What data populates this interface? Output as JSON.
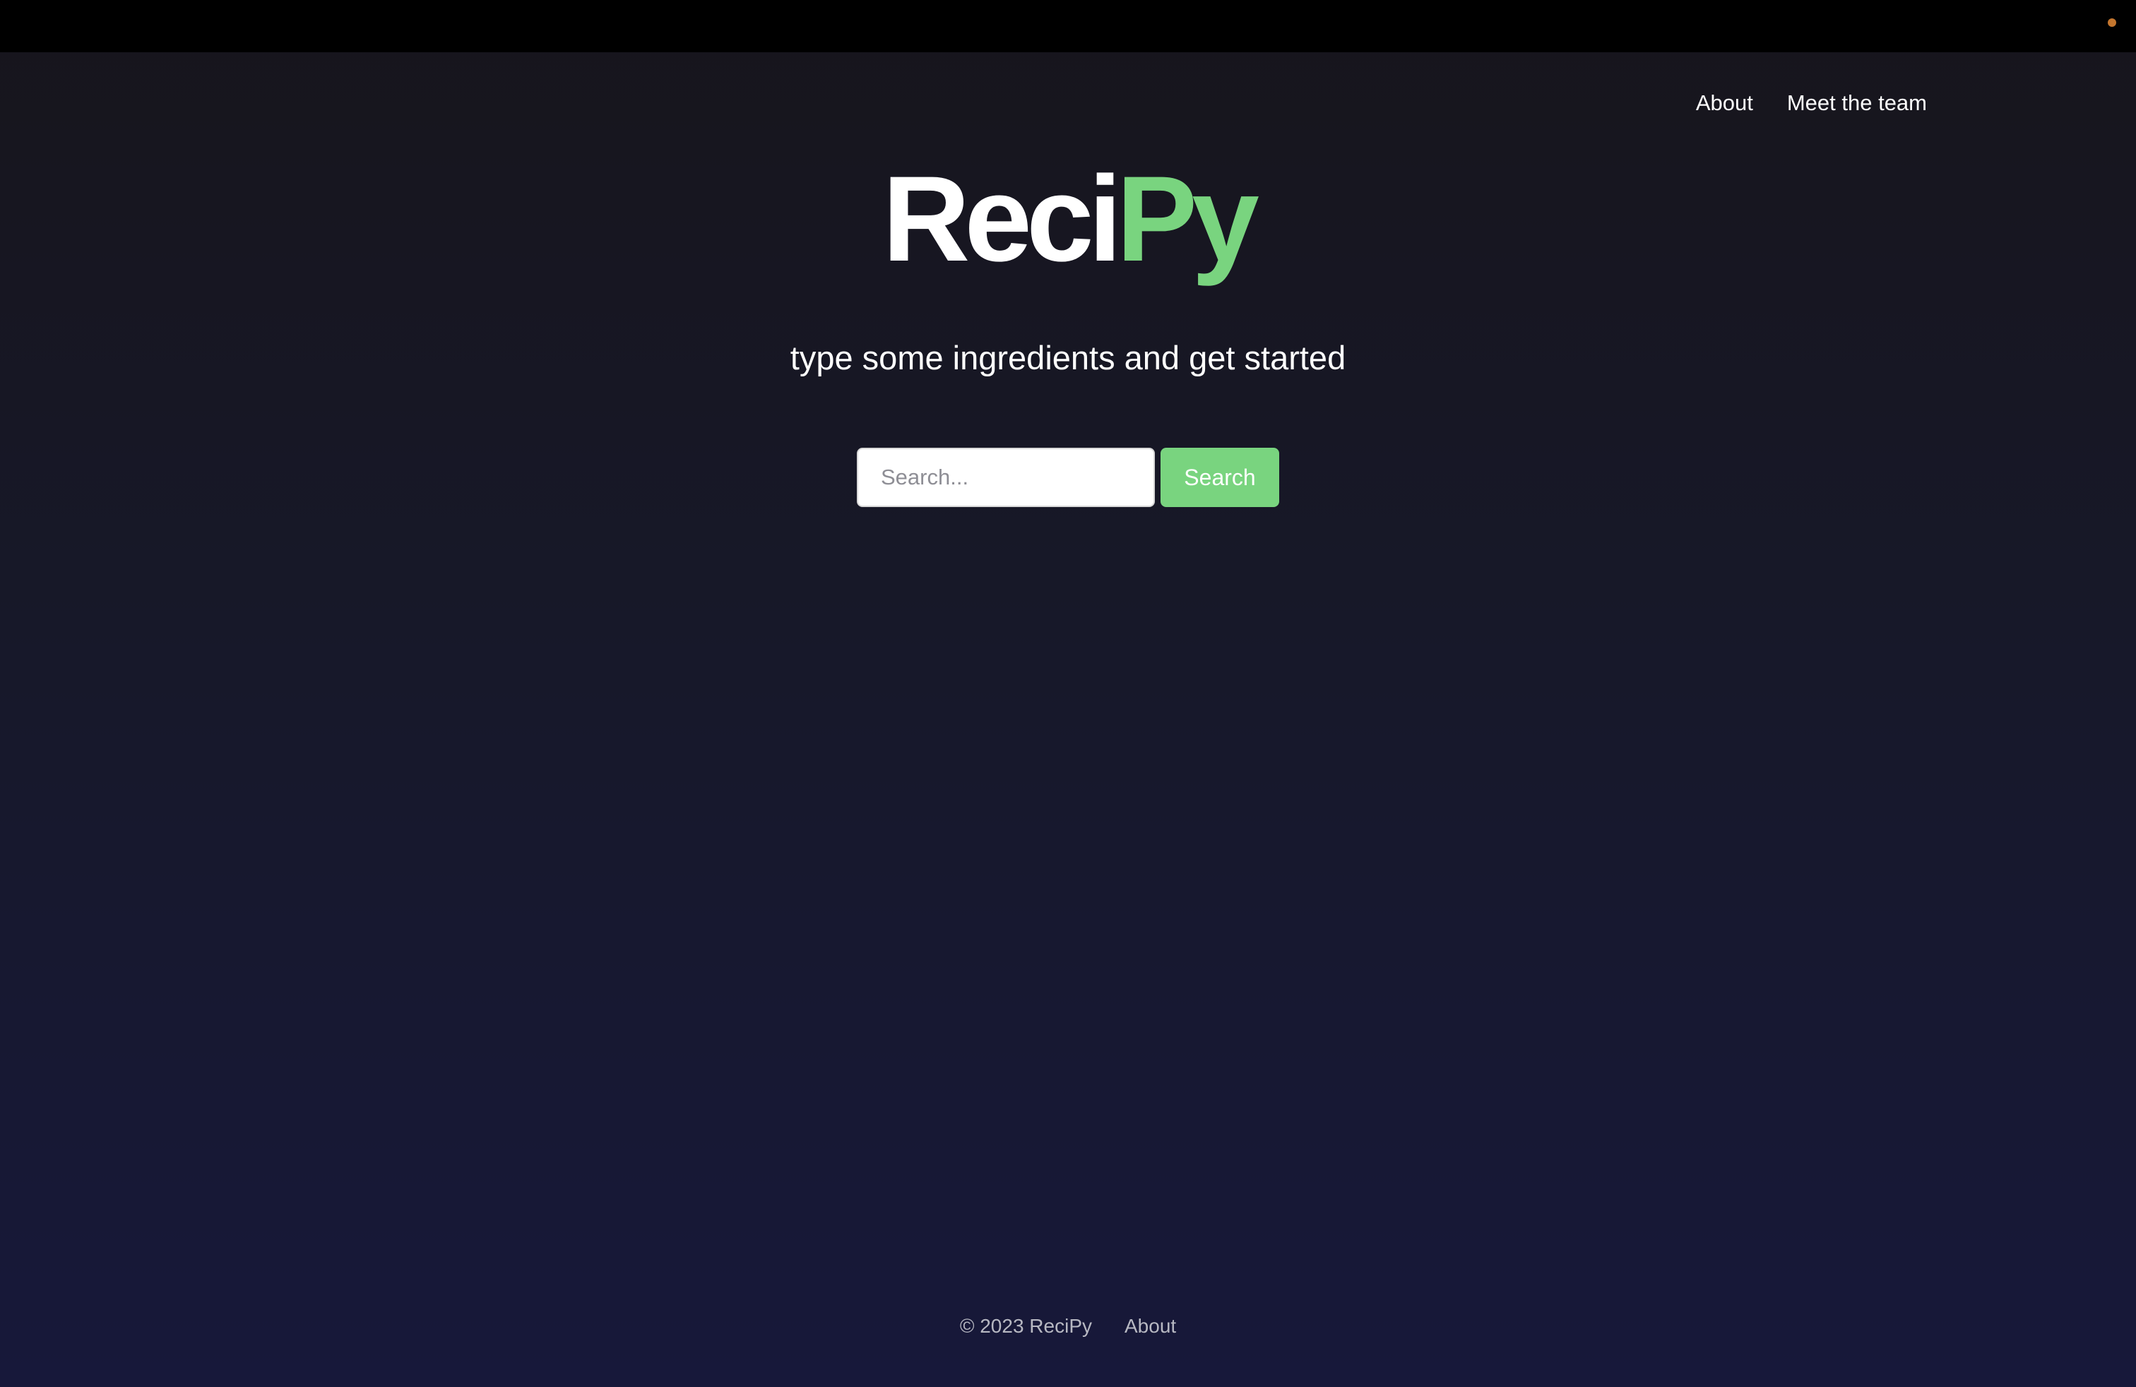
{
  "colors": {
    "accent": "#79d47f",
    "background_top": "#17151c",
    "background_bottom": "#17183a",
    "system_bar": "#000000",
    "camera_indicator": "#c4762e"
  },
  "header": {
    "nav": [
      {
        "label": "About"
      },
      {
        "label": "Meet the team"
      }
    ]
  },
  "hero": {
    "logo_part_a": "Reci",
    "logo_part_b": "Py",
    "tagline": "type some ingredients and get started"
  },
  "search": {
    "placeholder": "Search...",
    "value": "",
    "button_label": "Search"
  },
  "footer": {
    "copyright": "© 2023 ReciPy",
    "link_label": "About"
  }
}
